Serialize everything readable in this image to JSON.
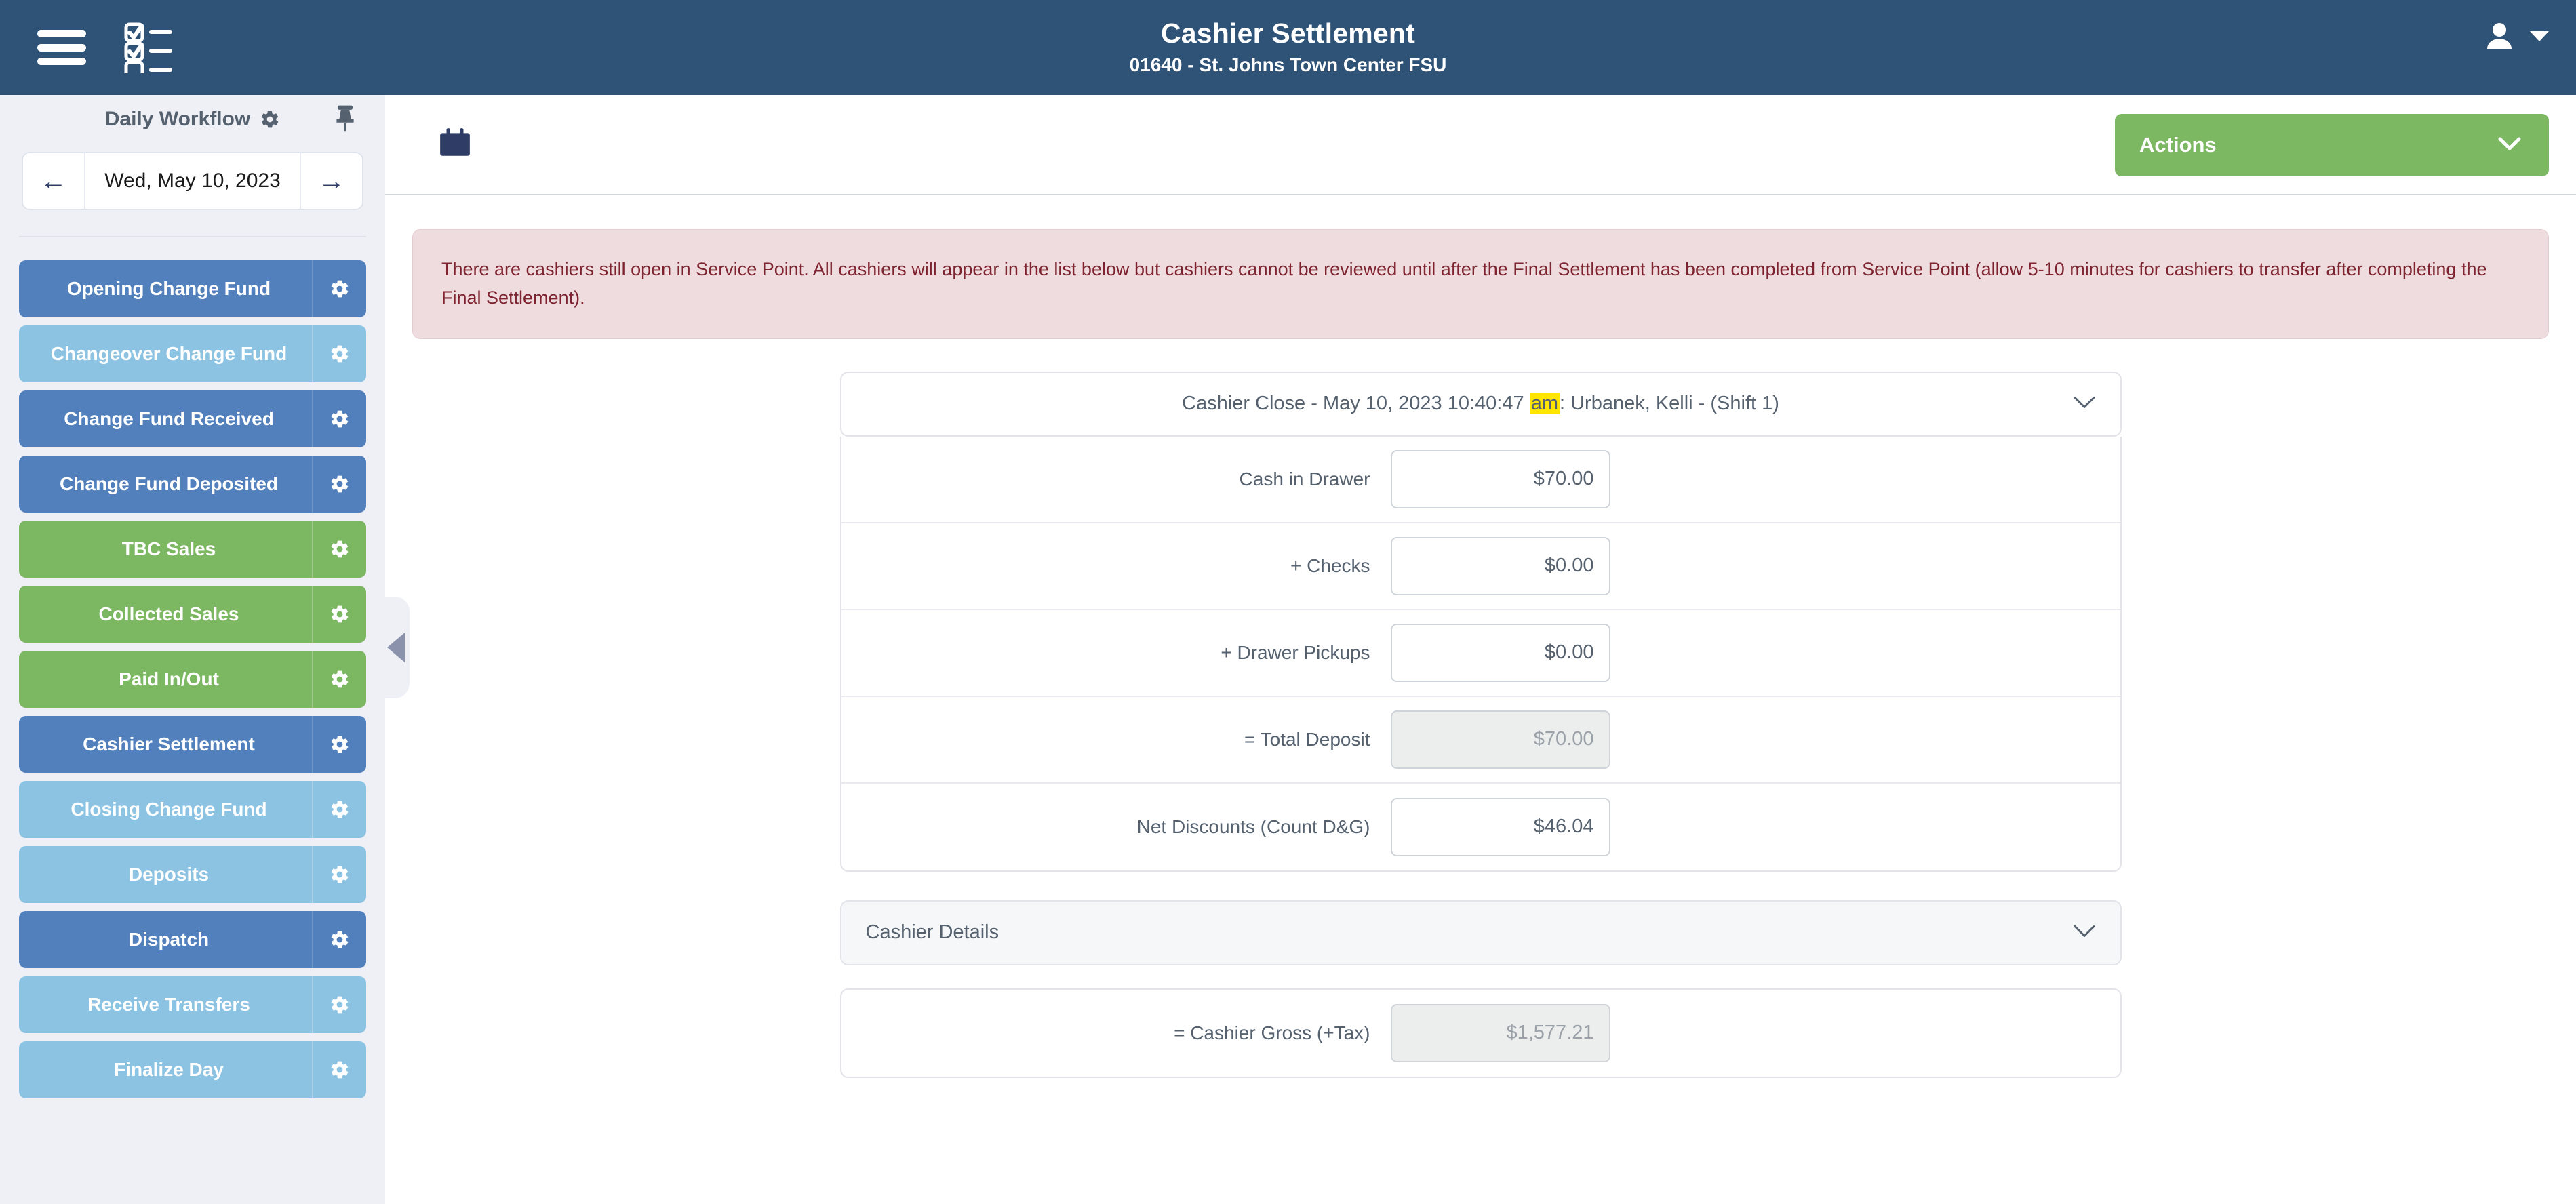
{
  "header": {
    "title": "Cashier Settlement",
    "subtitle": "01640 - St. Johns Town Center FSU",
    "menu_icon": "hamburger-menu-icon",
    "checklist_icon": "checklist-icon",
    "user_icon": "user-account-icon"
  },
  "sidebar": {
    "title": "Daily Workflow",
    "gear_icon": "gear-icon",
    "pin_icon": "pin-icon",
    "date": {
      "value": "Wed, May 10, 2023",
      "prev_label": "←",
      "next_label": "→"
    },
    "items": [
      {
        "label": "Opening Change Fund",
        "color": "blue"
      },
      {
        "label": "Changeover Change Fund",
        "color": "lblue"
      },
      {
        "label": "Change Fund Received",
        "color": "blue"
      },
      {
        "label": "Change Fund Deposited",
        "color": "blue"
      },
      {
        "label": "TBC Sales",
        "color": "green"
      },
      {
        "label": "Collected Sales",
        "color": "green"
      },
      {
        "label": "Paid In/Out",
        "color": "green"
      },
      {
        "label": "Cashier Settlement",
        "color": "blue"
      },
      {
        "label": "Closing Change Fund",
        "color": "lblue"
      },
      {
        "label": "Deposits",
        "color": "lblue"
      },
      {
        "label": "Dispatch",
        "color": "blue"
      },
      {
        "label": "Receive Transfers",
        "color": "lblue"
      },
      {
        "label": "Finalize Day",
        "color": "lblue"
      }
    ]
  },
  "toolbar": {
    "calendar_icon": "calendar-icon",
    "actions_label": "Actions",
    "actions_chevron_icon": "chevron-down-icon"
  },
  "alert": {
    "text": "There are cashiers still open in Service Point. All cashiers will appear in the list below but cashiers cannot be reviewed until after the Final Settlement has been completed from Service Point (allow 5-10 minutes for cashiers to transfer after completing the Final Settlement)."
  },
  "cashier_close": {
    "title_before": "Cashier Close - May 10, 2023 10:40:47 ",
    "title_highlight": "am",
    "title_after": ": Urbanek, Kelli - (Shift 1)",
    "chevron_icon": "chevron-down-icon",
    "fields": [
      {
        "label": "Cash in Drawer",
        "value": "$70.00",
        "disabled": false
      },
      {
        "label": "+ Checks",
        "value": "$0.00",
        "disabled": false
      },
      {
        "label": "+ Drawer Pickups",
        "value": "$0.00",
        "disabled": false
      },
      {
        "label": "= Total Deposit",
        "value": "$70.00",
        "disabled": true
      },
      {
        "label": "Net Discounts (Count D&G)",
        "value": "$46.04",
        "disabled": false
      }
    ]
  },
  "cashier_details": {
    "title": "Cashier Details",
    "chevron_icon": "chevron-down-icon",
    "fields": [
      {
        "label": "= Cashier Gross (+Tax)",
        "value": "$1,577.21",
        "disabled": true
      }
    ]
  },
  "colors": {
    "header_bg": "#2f5277",
    "sidebar_bg": "#eef0f5",
    "nav_blue": "#5180bd",
    "nav_light_blue": "#8cc3e3",
    "nav_green": "#7cb762",
    "accent_green": "#7cb762",
    "alert_bg": "#efdcdf",
    "alert_text": "#7e2430",
    "highlight": "#ffe600"
  }
}
